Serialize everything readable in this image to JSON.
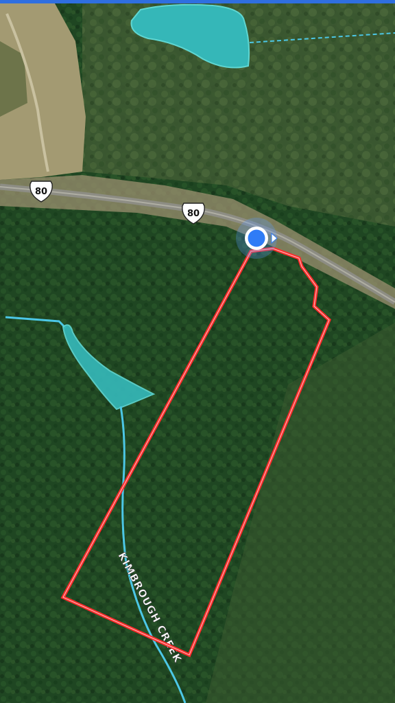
{
  "map": {
    "highway_shields": [
      {
        "label": "80"
      },
      {
        "label": "80"
      }
    ],
    "creek_label": "KIMBROUGH CREEK",
    "colors": {
      "top_accent": "#2f6fe0",
      "parcel_outline": "#ff2a2a",
      "water": "#35b7b8",
      "stream": "#4cc7e6",
      "location_dot": "#2f7cf6",
      "forest_dark": "#1d4520",
      "field": "#a39a72"
    },
    "icons": {
      "location": "current-location-icon",
      "heading": "heading-arrow-icon",
      "shield": "us-highway-shield-icon"
    }
  }
}
